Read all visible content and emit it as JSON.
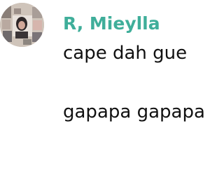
{
  "sender": {
    "name": "R, Mieylla",
    "color": "#3fae9a"
  },
  "message": {
    "lines": [
      "cape dah gue",
      "gapapa gapapa"
    ]
  },
  "avatar": {
    "icon": "profile-photo"
  }
}
